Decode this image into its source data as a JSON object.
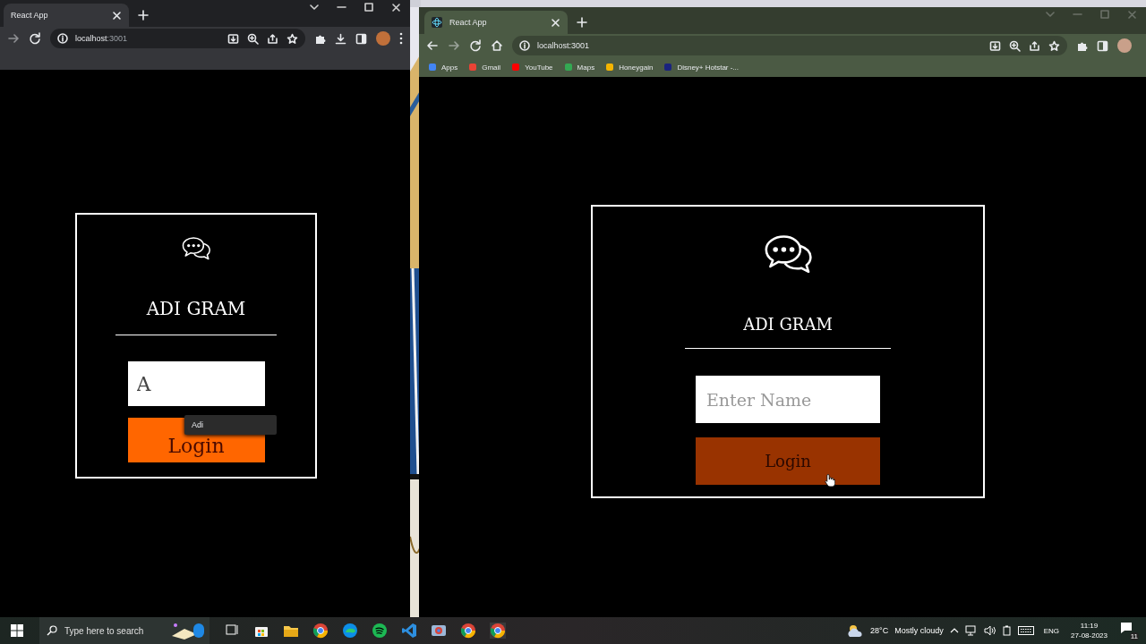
{
  "windows": [
    {
      "kind": "dark",
      "tabs": [
        {
          "title": "React App",
          "selected": true
        }
      ],
      "address": {
        "host": "localhost",
        "port": ":3001"
      },
      "app": {
        "title": "ADI GRAM",
        "name_field": {
          "value": "A"
        },
        "autocomplete": [
          "Adi"
        ],
        "login_button": {
          "label": "Login",
          "hovered": false
        }
      }
    },
    {
      "kind": "green",
      "tabs": [
        {
          "title": "React App",
          "selected": true
        }
      ],
      "address": {
        "host": "localhost",
        "port": ":3001"
      },
      "bookmarks": [
        "Apps",
        "Gmail",
        "YouTube",
        "Maps",
        "Honeygain",
        "Disney+ Hotstar -..."
      ],
      "app": {
        "title": "ADI GRAM",
        "name_field": {
          "placeholder": "Enter Name"
        },
        "login_button": {
          "label": "Login",
          "hovered": true
        }
      }
    }
  ],
  "taskbar": {
    "search_placeholder": "Type here to search",
    "weather": {
      "temperature": "28°C",
      "condition": "Mostly cloudy"
    },
    "language": "ENG",
    "time": "11:19",
    "date": "27-08-2023",
    "notification_count": "11"
  }
}
